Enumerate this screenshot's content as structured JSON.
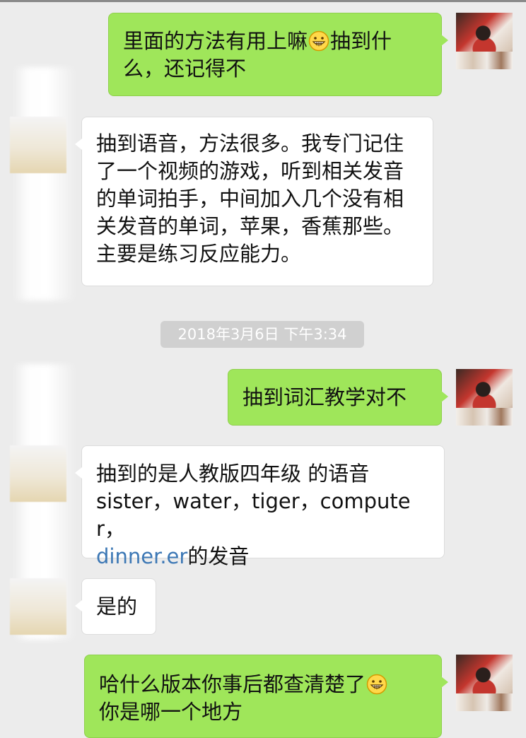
{
  "timestamp": "2018年3月6日 下午3:34",
  "messages": [
    {
      "text_1": "里面的方法有用上嘛",
      "emoji": "grinning-face-emoji",
      "text_2": "抽到什么，还记得不"
    },
    {
      "text": "抽到语音，方法很多。我专门记住了一个视频的游戏，听到相关发音的单词拍手，中间加入几个没有相关发音的单词，苹果，香蕉那些。主要是练习反应能力。"
    },
    {
      "text": "抽到词汇教学对不"
    },
    {
      "line_1": "抽到的是人教版四年级 的语音",
      "line_2": "sister，water，tiger，computer，",
      "link": "dinner.er",
      "line_3_tail": "的发音"
    },
    {
      "text": "是的"
    },
    {
      "text_1": "哈什么版本你事后都查清楚了",
      "emoji": "grinning-face-emoji",
      "text_2": "你是哪一个地方"
    }
  ],
  "colors": {
    "background": "#ececec",
    "outgoing_bubble": "#9fe65a",
    "incoming_bubble": "#ffffff",
    "link": "#3d78b5",
    "timestamp_badge": "#d0d0d0"
  }
}
